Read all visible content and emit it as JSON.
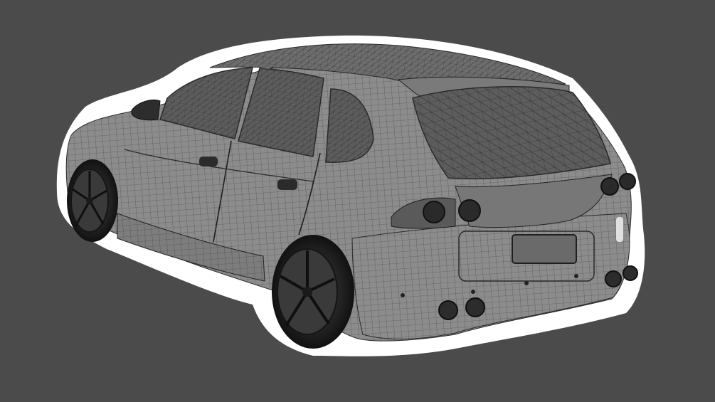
{
  "image": {
    "subject": "car-wireframe-render",
    "colors": {
      "background": "#4b4b4b",
      "outline": "#ffffff",
      "body": "#8c8c8c",
      "body_dark": "#6e6e6e",
      "glass": "#5d5d5d",
      "wire": "#2a2a2a",
      "tire": "#1c1c1c",
      "rim": "#3a3a3a"
    }
  }
}
